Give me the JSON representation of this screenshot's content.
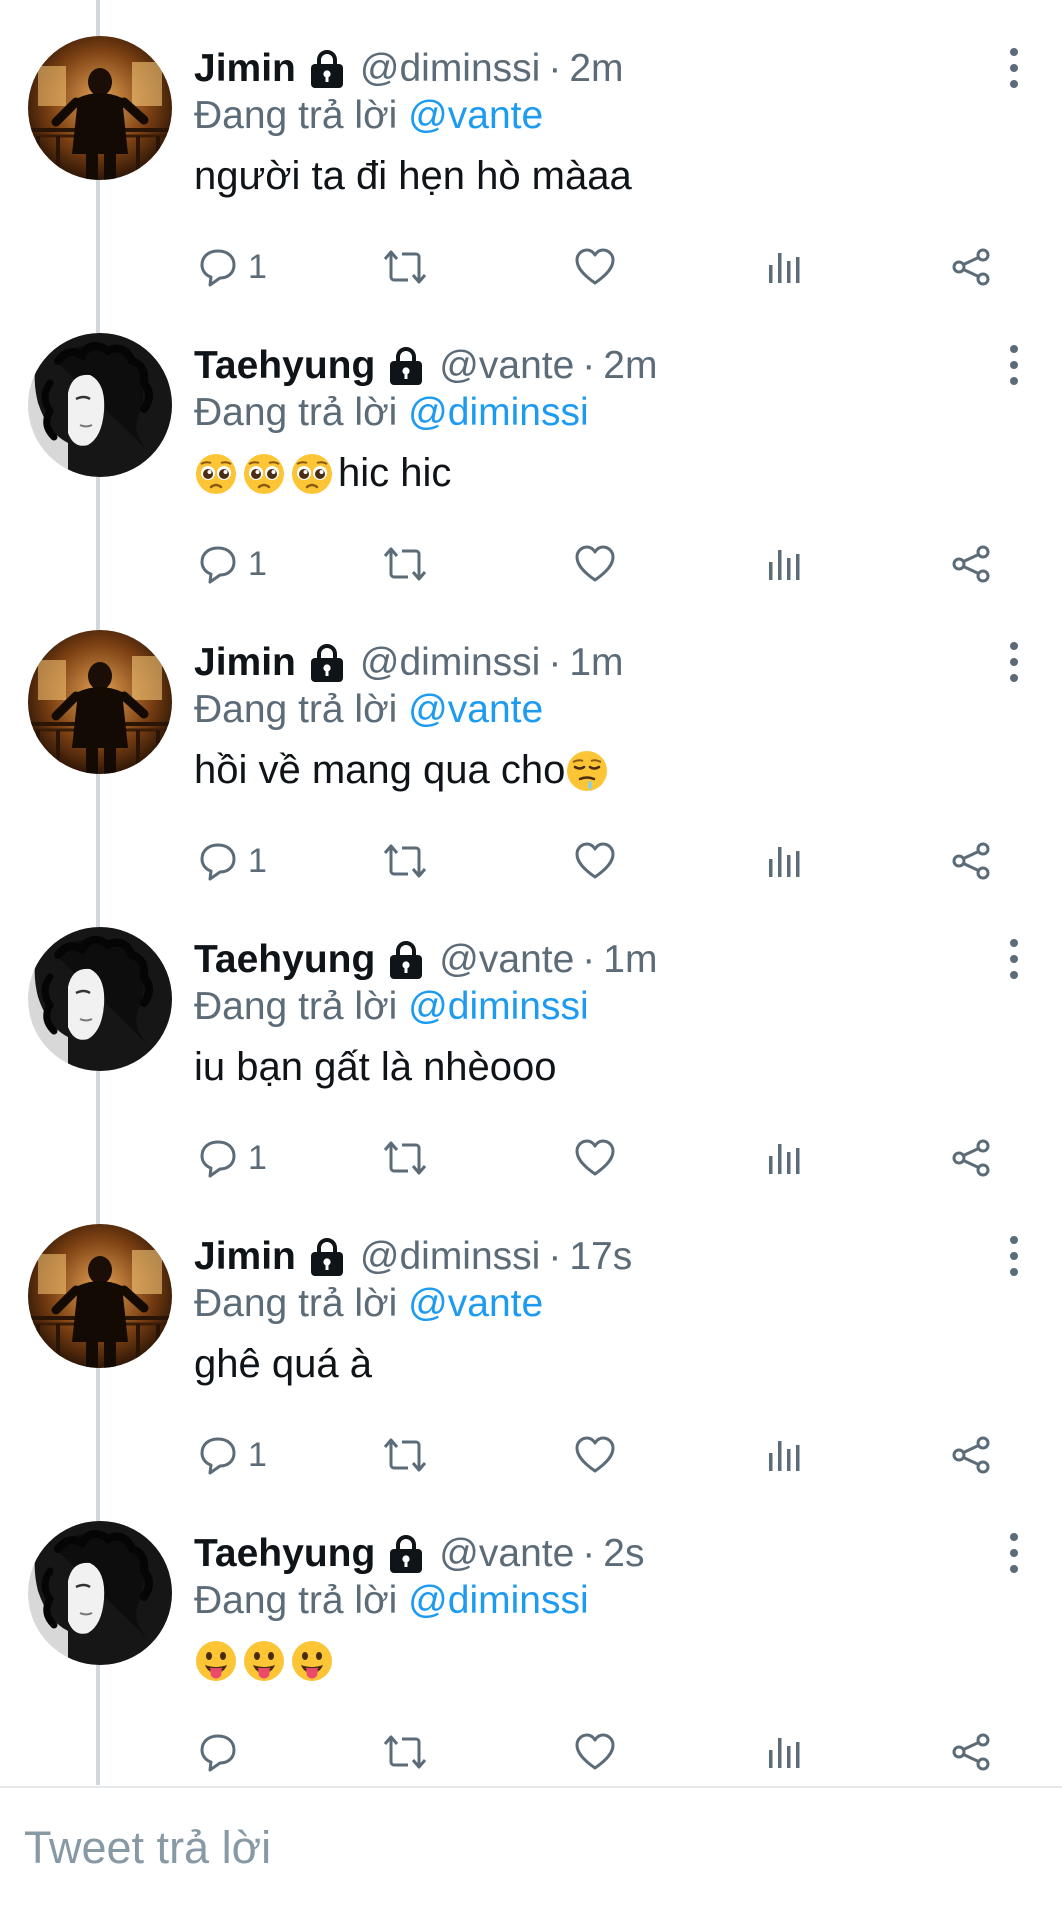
{
  "tweets": [
    {
      "author": "Jimin",
      "handle": "@diminssi",
      "time": "2m",
      "reply_prefix": "Đang trả lời",
      "reply_mention": "@vante",
      "text": "người ta đi hẹn hò màaa",
      "emojis_before": [],
      "emojis_after": [],
      "reply_count": "1",
      "avatar": "jimin"
    },
    {
      "author": "Taehyung",
      "handle": "@vante",
      "time": "2m",
      "reply_prefix": "Đang trả lời",
      "reply_mention": "@diminssi",
      "text": "hic hic",
      "emojis_before": [
        "pleading-face-emoji",
        "pleading-face-emoji",
        "pleading-face-emoji"
      ],
      "emojis_after": [],
      "reply_count": "1",
      "avatar": "taehyung"
    },
    {
      "author": "Jimin",
      "handle": "@diminssi",
      "time": "1m",
      "reply_prefix": "Đang trả lời",
      "reply_mention": "@vante",
      "text": "hồi về mang qua cho",
      "emojis_before": [],
      "emojis_after": [
        "weary-drooling-face-emoji"
      ],
      "reply_count": "1",
      "avatar": "jimin"
    },
    {
      "author": "Taehyung",
      "handle": "@vante",
      "time": "1m",
      "reply_prefix": "Đang trả lời",
      "reply_mention": "@diminssi",
      "text": "iu bạn gất là nhèooo",
      "emojis_before": [],
      "emojis_after": [],
      "reply_count": "1",
      "avatar": "taehyung"
    },
    {
      "author": "Jimin",
      "handle": "@diminssi",
      "time": "17s",
      "reply_prefix": "Đang trả lời",
      "reply_mention": "@vante",
      "text": "ghê quá à",
      "emojis_before": [],
      "emojis_after": [],
      "reply_count": "1",
      "avatar": "jimin"
    },
    {
      "author": "Taehyung",
      "handle": "@vante",
      "time": "2s",
      "reply_prefix": "Đang trả lời",
      "reply_mention": "@diminssi",
      "text": "",
      "emojis_before": [
        "tongue-face-emoji",
        "tongue-face-emoji",
        "tongue-face-emoji"
      ],
      "emojis_after": [],
      "reply_count": "",
      "avatar": "taehyung"
    }
  ],
  "reply_box": {
    "placeholder": "Tweet trả lời"
  },
  "colors": {
    "mention": "#1d9bf0",
    "secondary_text": "#5b6b78",
    "icon": "#5b6b78",
    "thread_line": "#d3d6db"
  },
  "icons": [
    "avatar",
    "lock-icon",
    "more-options-icon",
    "reply-icon",
    "retweet-icon",
    "like-icon",
    "analytics-icon",
    "share-icon"
  ]
}
